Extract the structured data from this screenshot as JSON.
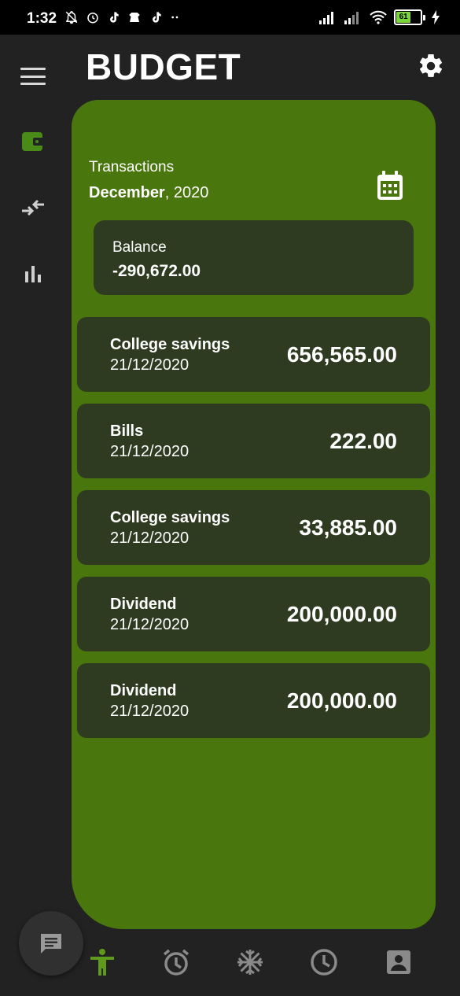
{
  "status_bar": {
    "time": "1:32",
    "battery_level": "61"
  },
  "header": {
    "title": "BUDGET"
  },
  "side_rail": {
    "items": [
      {
        "icon": "wallet-icon",
        "active": true
      },
      {
        "icon": "transfer-arrows-icon",
        "active": false
      },
      {
        "icon": "bar-chart-icon",
        "active": false
      }
    ]
  },
  "summary": {
    "section_label": "Transactions",
    "month": "December",
    "year": ", 2020",
    "balance_label": "Balance",
    "balance_value": "-290,672.00"
  },
  "transactions": [
    {
      "name": "College savings",
      "date": "21/12/2020",
      "amount": "656,565.00"
    },
    {
      "name": "Bills",
      "date": "21/12/2020",
      "amount": "222.00"
    },
    {
      "name": "College savings",
      "date": "21/12/2020",
      "amount": "33,885.00"
    },
    {
      "name": "Dividend",
      "date": "21/12/2020",
      "amount": "200,000.00"
    },
    {
      "name": "Dividend",
      "date": "21/12/2020",
      "amount": "200,000.00"
    }
  ],
  "bottom_nav": {
    "items": [
      {
        "icon": "accessibility-icon",
        "active": true
      },
      {
        "icon": "alarm-icon",
        "active": false
      },
      {
        "icon": "snowflake-icon",
        "active": false
      },
      {
        "icon": "clock-icon",
        "active": false
      },
      {
        "icon": "contact-card-icon",
        "active": false
      }
    ]
  },
  "colors": {
    "background": "#222222",
    "panel": "#4a770d",
    "card": "#2e3b21",
    "accent": "#4a7f14",
    "active_icon": "#5f9a1c"
  }
}
